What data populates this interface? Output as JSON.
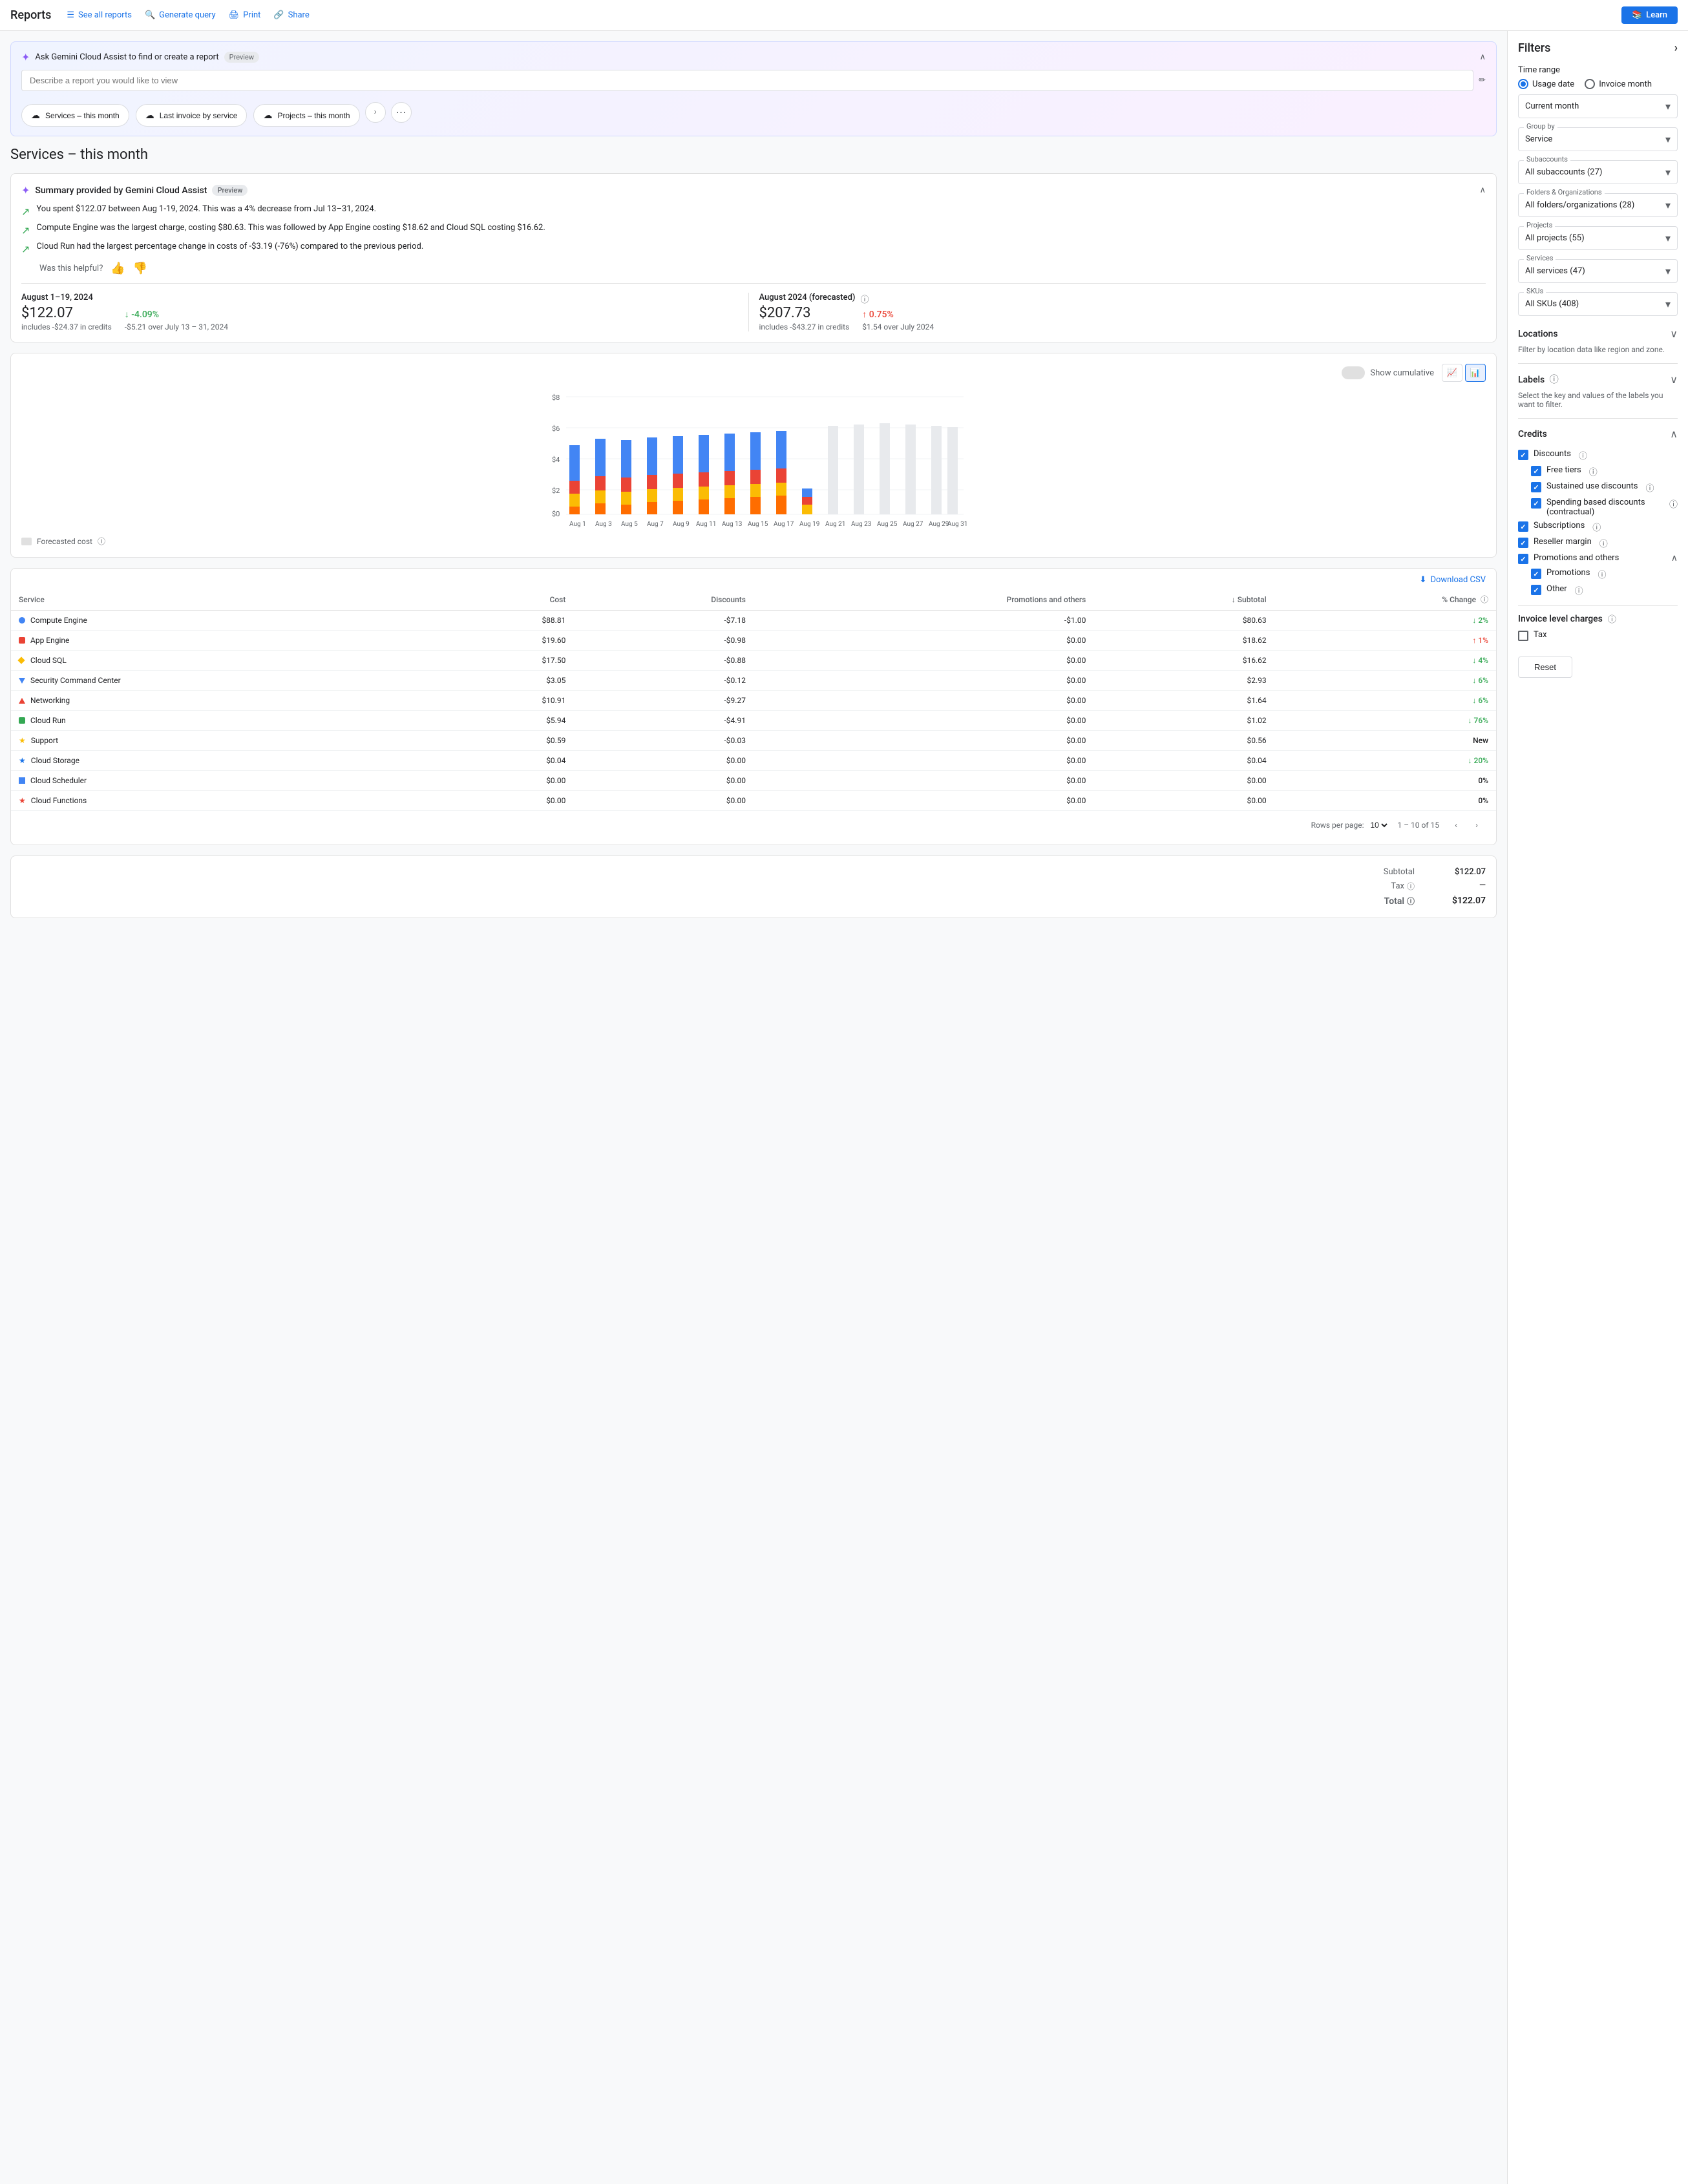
{
  "nav": {
    "title": "Reports",
    "links": [
      {
        "id": "see-all-reports",
        "label": "See all reports",
        "icon": "list-icon"
      },
      {
        "id": "generate-query",
        "label": "Generate query",
        "icon": "search-icon"
      },
      {
        "id": "print",
        "label": "Print",
        "icon": "print-icon"
      },
      {
        "id": "share",
        "label": "Share",
        "icon": "share-icon"
      }
    ],
    "learn_label": "Learn"
  },
  "gemini": {
    "title": "Ask Gemini Cloud Assist to find or create a report",
    "preview_badge": "Preview",
    "input_placeholder": "Describe a report you would like to view",
    "quick_links": [
      {
        "id": "services-month",
        "label": "Services – this month"
      },
      {
        "id": "last-invoice",
        "label": "Last invoice by service"
      },
      {
        "id": "projects-month",
        "label": "Projects – this month"
      }
    ]
  },
  "page_title": "Services – this month",
  "summary": {
    "title": "Summary provided by Gemini Cloud Assist",
    "preview_badge": "Preview",
    "items": [
      "You spent $122.07 between Aug 1-19, 2024. This was a 4% decrease from Jul 13–31, 2024.",
      "Compute Engine was the largest charge, costing $80.63. This was followed by App Engine costing $18.62 and Cloud SQL costing $16.62.",
      "Cloud Run had the largest percentage change in costs of -$3.19 (-76%) compared to the previous period."
    ],
    "helpful_label": "Was this helpful?"
  },
  "metrics": {
    "current": {
      "period": "August 1–19, 2024",
      "amount": "$122.07",
      "credits": "includes -$24.37 in credits",
      "change": "-4.09%",
      "change_type": "down",
      "change_detail": "-$5.21 over July 13 – 31, 2024"
    },
    "forecasted": {
      "period": "August 2024 (forecasted)",
      "amount": "$207.73",
      "credits": "includes -$43.27 in credits",
      "change": "0.75%",
      "change_type": "up-red",
      "change_detail": "$1.54 over July 2024"
    }
  },
  "chart": {
    "show_cumulative_label": "Show cumulative",
    "y_labels": [
      "$8",
      "$6",
      "$4",
      "$2",
      "$0"
    ],
    "x_labels": [
      "Aug 1",
      "Aug 3",
      "Aug 5",
      "Aug 7",
      "Aug 9",
      "Aug 11",
      "Aug 13",
      "Aug 15",
      "Aug 17",
      "Aug 19",
      "Aug 21",
      "Aug 23",
      "Aug 25",
      "Aug 27",
      "Aug 29",
      "Aug 31"
    ],
    "forecasted_legend": "Forecasted cost"
  },
  "table": {
    "download_label": "Download CSV",
    "columns": [
      {
        "id": "service",
        "label": "Service"
      },
      {
        "id": "cost",
        "label": "Cost",
        "align": "right"
      },
      {
        "id": "discounts",
        "label": "Discounts",
        "align": "right"
      },
      {
        "id": "promotions",
        "label": "Promotions and others",
        "align": "right"
      },
      {
        "id": "subtotal",
        "label": "Subtotal",
        "align": "right",
        "sort": true
      },
      {
        "id": "change",
        "label": "% Change",
        "align": "right"
      }
    ],
    "rows": [
      {
        "service": "Compute Engine",
        "color": "#4285f4",
        "shape": "dot",
        "cost": "$88.81",
        "discounts": "-$7.18",
        "promotions": "-$1.00",
        "subtotal": "$80.63",
        "change": "2%",
        "change_dir": "down"
      },
      {
        "service": "App Engine",
        "color": "#ea4335",
        "shape": "square",
        "cost": "$19.60",
        "discounts": "-$0.98",
        "promotions": "$0.00",
        "subtotal": "$18.62",
        "change": "1%",
        "change_dir": "up"
      },
      {
        "service": "Cloud SQL",
        "color": "#fbbc04",
        "shape": "diamond",
        "cost": "$17.50",
        "discounts": "-$0.88",
        "promotions": "$0.00",
        "subtotal": "$16.62",
        "change": "4%",
        "change_dir": "down"
      },
      {
        "service": "Security Command Center",
        "color": "#4285f4",
        "shape": "triangle-down",
        "cost": "$3.05",
        "discounts": "-$0.12",
        "promotions": "$0.00",
        "subtotal": "$2.93",
        "change": "6%",
        "change_dir": "down"
      },
      {
        "service": "Networking",
        "color": "#ea4335",
        "shape": "tri-up",
        "cost": "$10.91",
        "discounts": "-$9.27",
        "promotions": "$0.00",
        "subtotal": "$1.64",
        "change": "6%",
        "change_dir": "down"
      },
      {
        "service": "Cloud Run",
        "color": "#34a853",
        "shape": "square",
        "cost": "$5.94",
        "discounts": "-$4.91",
        "promotions": "$0.00",
        "subtotal": "$1.02",
        "change": "76%",
        "change_dir": "down"
      },
      {
        "service": "Support",
        "color": "#fbbc04",
        "shape": "star",
        "cost": "$0.59",
        "discounts": "-$0.03",
        "promotions": "$0.00",
        "subtotal": "$0.56",
        "change": "New",
        "change_dir": "new"
      },
      {
        "service": "Cloud Storage",
        "color": "#1a73e8",
        "shape": "star-outline",
        "cost": "$0.04",
        "discounts": "$0.00",
        "promotions": "$0.00",
        "subtotal": "$0.04",
        "change": "20%",
        "change_dir": "down"
      },
      {
        "service": "Cloud Scheduler",
        "color": "#4285f4",
        "shape": "square-sm",
        "cost": "$0.00",
        "discounts": "$0.00",
        "promotions": "$0.00",
        "subtotal": "$0.00",
        "change": "0%",
        "change_dir": "neutral"
      },
      {
        "service": "Cloud Functions",
        "color": "#ea4335",
        "shape": "star-pink",
        "cost": "$0.00",
        "discounts": "$0.00",
        "promotions": "$0.00",
        "subtotal": "$0.00",
        "change": "0%",
        "change_dir": "neutral"
      }
    ],
    "pagination": {
      "rows_per_page_label": "Rows per page:",
      "rows_per_page": "10",
      "page_info": "1 – 10 of 15"
    }
  },
  "totals": {
    "subtotal_label": "Subtotal",
    "subtotal_value": "$122.07",
    "tax_label": "Tax",
    "tax_value": "—",
    "total_label": "Total",
    "total_value": "$122.07"
  },
  "filters": {
    "title": "Filters",
    "time_range_label": "Time range",
    "usage_date_label": "Usage date",
    "invoice_month_label": "Invoice month",
    "current_month_label": "Current month",
    "group_by_label": "Group by",
    "group_by_value": "Service",
    "subaccounts_label": "Subaccounts",
    "subaccounts_value": "All subaccounts (27)",
    "folders_label": "Folders & Organizations",
    "folders_value": "All folders/organizations (28)",
    "projects_label": "Projects",
    "projects_value": "All projects (55)",
    "services_label": "Services",
    "services_value": "All services (47)",
    "skus_label": "SKUs",
    "skus_value": "All SKUs (408)",
    "locations_label": "Locations",
    "locations_info": "Filter by location data like region and zone.",
    "labels_label": "Labels",
    "labels_info": "Select the key and values of the labels you want to filter.",
    "credits_label": "Credits",
    "discounts_label": "Discounts",
    "free_tiers_label": "Free tiers",
    "sustained_label": "Sustained use discounts",
    "spending_label": "Spending based discounts (contractual)",
    "subscriptions_label": "Subscriptions",
    "reseller_label": "Reseller margin",
    "promotions_others_label": "Promotions and others",
    "promotions_label": "Promotions",
    "other_label": "Other",
    "invoice_charges_label": "Invoice level charges",
    "tax_label": "Tax",
    "reset_label": "Reset"
  }
}
